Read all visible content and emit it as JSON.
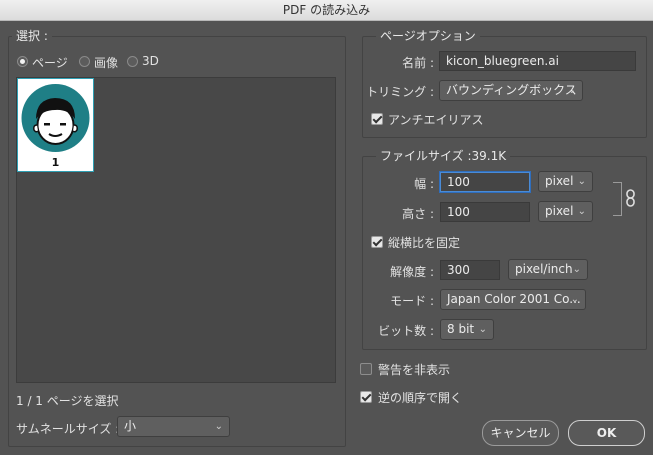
{
  "window": {
    "title": "PDF の読み込み"
  },
  "select_panel": {
    "legend": "選択 :",
    "radios": [
      {
        "label": "ページ",
        "checked": true
      },
      {
        "label": "画像",
        "checked": false
      },
      {
        "label": "3D",
        "checked": false
      }
    ],
    "thumbnail_page_number": "1",
    "selection_status": "1 / 1 ページを選択",
    "thumbnail_size_label": "サムネールサイズ :",
    "thumbnail_size_value": "小"
  },
  "page_options": {
    "legend": "ページオプション",
    "name_label": "名前 :",
    "name_value": "kicon_bluegreen.ai",
    "crop_label": "トリミング :",
    "crop_value": "バウンディングボックス",
    "antialias_label": "アンチエイリアス",
    "antialias_checked": true
  },
  "image_size": {
    "legend": "ファイルサイズ :39.1K",
    "width_label": "幅 :",
    "width_value": "100",
    "width_unit": "pixel",
    "height_label": "高さ :",
    "height_value": "100",
    "height_unit": "pixel",
    "constrain_label": "縦横比を固定",
    "constrain_checked": true,
    "resolution_label": "解像度 :",
    "resolution_value": "300",
    "resolution_unit": "pixel/inch",
    "mode_label": "モード :",
    "mode_value": "Japan Color 2001 Co...",
    "bitdepth_label": "ビット数 :",
    "bitdepth_value": "8 bit"
  },
  "options": {
    "suppress_warnings_label": "警告を非表示",
    "suppress_warnings_checked": false,
    "reverse_order_label": "逆の順序で開く",
    "reverse_order_checked": true
  },
  "buttons": {
    "cancel": "キャンセル",
    "ok": "OK"
  },
  "colors": {
    "avatar_ring": "#1f7f86",
    "focus": "#4a8bd6",
    "selection": "#2e9fb3"
  }
}
